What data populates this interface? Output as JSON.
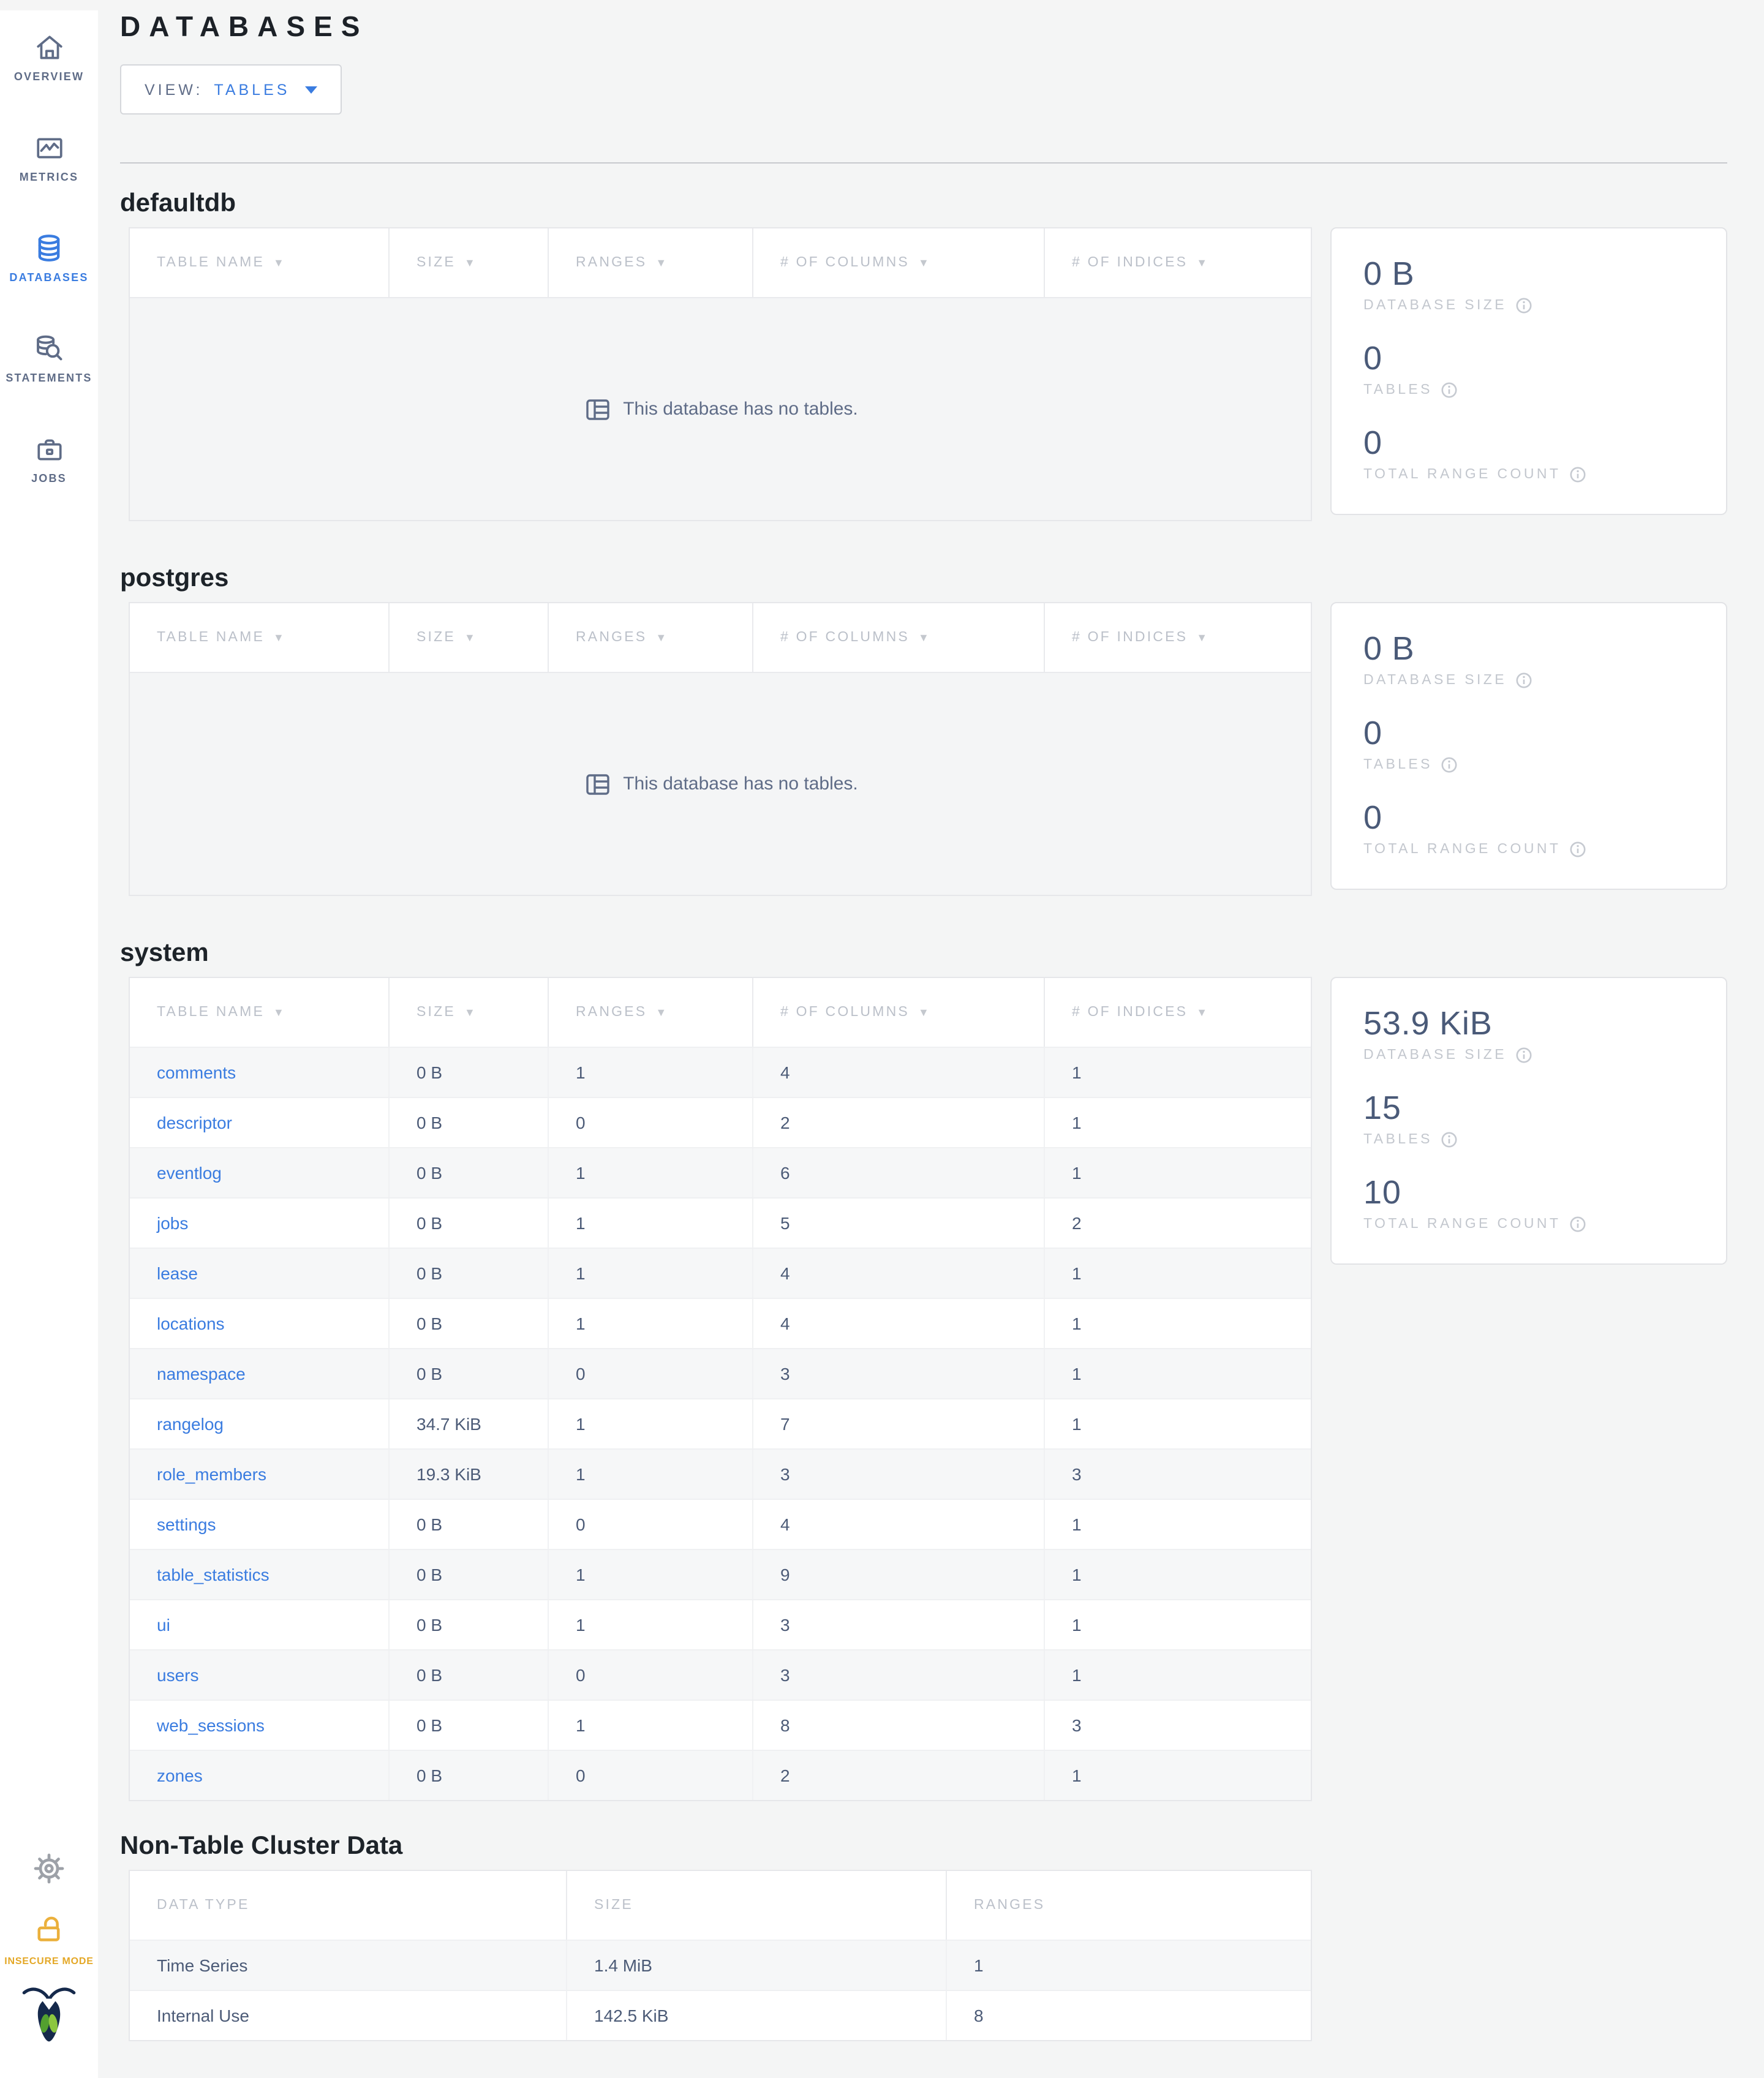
{
  "sidebar": {
    "items": [
      {
        "label": "OVERVIEW"
      },
      {
        "label": "METRICS"
      },
      {
        "label": "DATABASES"
      },
      {
        "label": "STATEMENTS"
      },
      {
        "label": "JOBS"
      }
    ],
    "insecure_label": "INSECURE MODE"
  },
  "header": {
    "title": "DATABASES",
    "view_label": "VIEW:",
    "view_value": "TABLES"
  },
  "columns": {
    "table_name": "TABLE NAME",
    "size": "SIZE",
    "ranges": "RANGES",
    "num_columns": "# OF COLUMNS",
    "num_indices": "# OF INDICES"
  },
  "stats_labels": {
    "database_size": "DATABASE SIZE",
    "tables": "TABLES",
    "total_range_count": "TOTAL RANGE COUNT"
  },
  "empty_message": "This database has no tables.",
  "databases": {
    "defaultdb": {
      "name": "defaultdb",
      "stats": {
        "size": "0 B",
        "tables": "0",
        "ranges": "0"
      }
    },
    "postgres": {
      "name": "postgres",
      "stats": {
        "size": "0 B",
        "tables": "0",
        "ranges": "0"
      }
    },
    "system": {
      "name": "system",
      "stats": {
        "size": "53.9 KiB",
        "tables": "15",
        "ranges": "10"
      },
      "tables": [
        {
          "name": "comments",
          "size": "0 B",
          "ranges": "1",
          "columns": "4",
          "indices": "1"
        },
        {
          "name": "descriptor",
          "size": "0 B",
          "ranges": "0",
          "columns": "2",
          "indices": "1"
        },
        {
          "name": "eventlog",
          "size": "0 B",
          "ranges": "1",
          "columns": "6",
          "indices": "1"
        },
        {
          "name": "jobs",
          "size": "0 B",
          "ranges": "1",
          "columns": "5",
          "indices": "2"
        },
        {
          "name": "lease",
          "size": "0 B",
          "ranges": "1",
          "columns": "4",
          "indices": "1"
        },
        {
          "name": "locations",
          "size": "0 B",
          "ranges": "1",
          "columns": "4",
          "indices": "1"
        },
        {
          "name": "namespace",
          "size": "0 B",
          "ranges": "0",
          "columns": "3",
          "indices": "1"
        },
        {
          "name": "rangelog",
          "size": "34.7 KiB",
          "ranges": "1",
          "columns": "7",
          "indices": "1"
        },
        {
          "name": "role_members",
          "size": "19.3 KiB",
          "ranges": "1",
          "columns": "3",
          "indices": "3"
        },
        {
          "name": "settings",
          "size": "0 B",
          "ranges": "0",
          "columns": "4",
          "indices": "1"
        },
        {
          "name": "table_statistics",
          "size": "0 B",
          "ranges": "1",
          "columns": "9",
          "indices": "1"
        },
        {
          "name": "ui",
          "size": "0 B",
          "ranges": "1",
          "columns": "3",
          "indices": "1"
        },
        {
          "name": "users",
          "size": "0 B",
          "ranges": "0",
          "columns": "3",
          "indices": "1"
        },
        {
          "name": "web_sessions",
          "size": "0 B",
          "ranges": "1",
          "columns": "8",
          "indices": "3"
        },
        {
          "name": "zones",
          "size": "0 B",
          "ranges": "0",
          "columns": "2",
          "indices": "1"
        }
      ]
    }
  },
  "non_table": {
    "title": "Non-Table Cluster Data",
    "columns": {
      "data_type": "DATA TYPE",
      "size": "SIZE",
      "ranges": "RANGES"
    },
    "rows": [
      {
        "data_type": "Time Series",
        "size": "1.4 MiB",
        "ranges": "1"
      },
      {
        "data_type": "Internal Use",
        "size": "142.5 KiB",
        "ranges": "8"
      }
    ]
  },
  "colors": {
    "accent_blue": "#3A7CE0",
    "slate": "#5F6C87",
    "warning_yellow": "#EBB03C"
  }
}
